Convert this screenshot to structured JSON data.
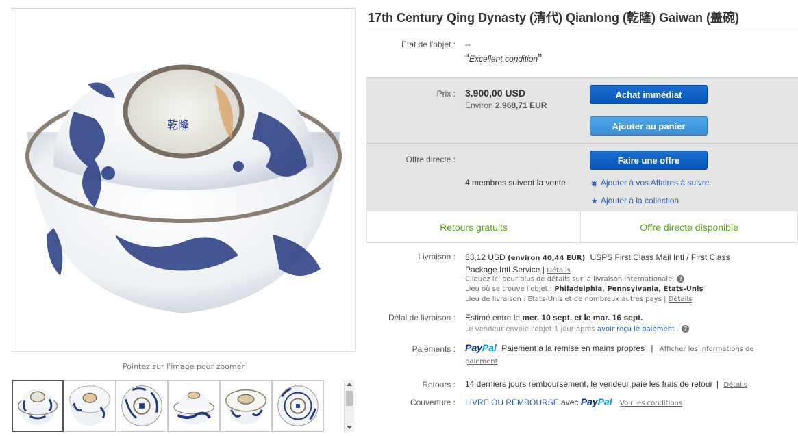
{
  "gallery": {
    "zoom_hint": "Pointez sur l'image pour zoomer",
    "thumbnails": [
      "thumb-1",
      "thumb-2",
      "thumb-3",
      "thumb-4",
      "thumb-5",
      "thumb-6"
    ],
    "selected_index": 0
  },
  "item": {
    "title": "17th Century Qing Dynasty (清代) Qianlong (乾隆) Gaiwan (盖碗)"
  },
  "condition": {
    "label": "Etat de l'objet :",
    "value": "--",
    "note": "Excellent condition"
  },
  "price": {
    "label": "Prix :",
    "amount": "3.900,00 USD",
    "approx_prefix": "Environ",
    "approx_amount": "2.968,71 EUR",
    "buy_now_label": "Achat immédiat",
    "add_cart_label": "Ajouter au panier"
  },
  "offer": {
    "label": "Offre directe :",
    "make_offer_label": "Faire une offre",
    "watchers": "4 membres suivent la vente",
    "watch_link": "Ajouter à vos Affaires à suivre",
    "collection_link": "Ajouter à la collection"
  },
  "perks": {
    "returns": "Retours gratuits",
    "best_offer": "Offre directe disponible"
  },
  "shipping": {
    "label": "Livraison :",
    "cost": "53,12 USD",
    "cost_approx": "(environ 40,44 EUR)",
    "service_line1": "USPS First Class Mail Intl / First Class",
    "service_line2": "Package Intl Service",
    "details": "Détails",
    "intl_note": "Cliquez ici pour plus de détails sur la livraison internationale.",
    "location_label": "Lieu où se trouve l'objet :",
    "location": "Philadelphia, Pennsylvania, États-Unis",
    "ships_to_label": "Lieu de livraison :",
    "ships_to": "Etats-Unis et de nombreux autres pays",
    "ships_to_details": "Détails"
  },
  "delivery": {
    "label": "Délai de livraison :",
    "prefix": "Estimé entre le",
    "range": "mer. 10 sept. et le mar. 16 sept.",
    "handling_prefix": "Le vendeur envoie l'objet 1 jour après",
    "handling_link": "avoir reçu le paiement"
  },
  "payments": {
    "label": "Paiements :",
    "paypal_p1": "Pay",
    "paypal_p2": "Pal",
    "text": "Paiement à la remise en mains propres",
    "info_link_1": "Afficher les informations de",
    "info_link_2": "paiement"
  },
  "returns": {
    "label": "Retours :",
    "text": "14 derniers jours remboursement, le vendeur paie les frais de retour",
    "details": "Détails"
  },
  "coverage": {
    "label": "Couverture :",
    "link": "LIVRE OU REMBOURSE",
    "with": "avec",
    "paypal_p1": "Pay",
    "paypal_p2": "Pal",
    "conditions": "Voir les conditions"
  },
  "colors": {
    "button_blue": "#0654ba",
    "button_light_blue": "#3a8fd8",
    "perk_green": "#5ba71b",
    "link_blue": "#2a5db0",
    "panel_gray": "#e5e5e5"
  }
}
